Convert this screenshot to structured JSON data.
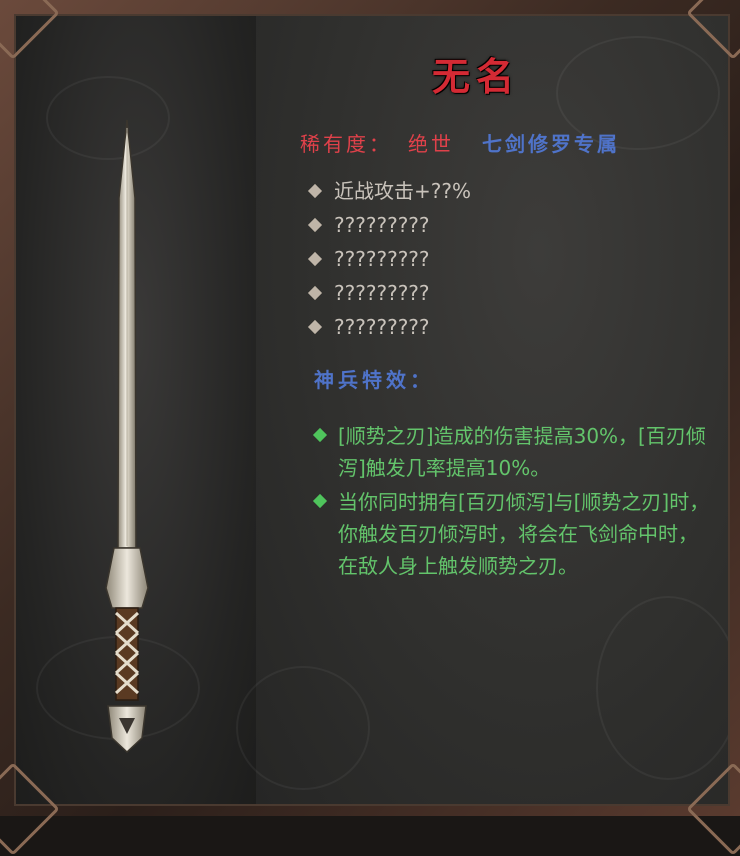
{
  "item": {
    "name": "无名",
    "rarity_label": "稀有度：",
    "rarity_value": "绝世",
    "exclusive_tag": "七剑修罗专属"
  },
  "stats": [
    "近战攻击+??%",
    "?????????",
    "?????????",
    "?????????",
    "?????????"
  ],
  "effects_title": "神兵特效：",
  "effects": [
    "[顺势之刃]造成的伤害提高30%，[百刃倾泻]触发几率提高10%。",
    "当你同时拥有[百刃倾泻]与[顺势之刃]时，你触发百刃倾泻时，将会在飞剑命中时，在敌人身上触发顺势之刃。"
  ],
  "colors": {
    "title": "#d42a34",
    "rarity": "#e0414a",
    "exclusive": "#4f73c9",
    "stat_text": "#c9c3bb",
    "effect_text": "#63c46b"
  },
  "icons": {
    "weapon": "sword-icon",
    "stat_bullet": "diamond-bullet-icon",
    "effect_bullet": "green-diamond-bullet-icon"
  }
}
